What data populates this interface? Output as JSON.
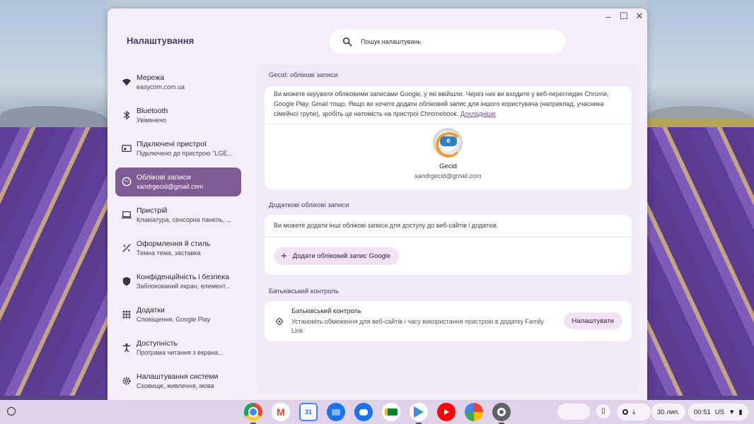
{
  "window": {
    "title": "Налаштування",
    "controls": {
      "minimize": "–",
      "maximize": "☐",
      "close": "✕"
    }
  },
  "search": {
    "placeholder": "Пошук налаштувань"
  },
  "sidebar": {
    "items": [
      {
        "title": "Мережа",
        "subtitle": "easycom.com.ua",
        "icon": "wifi-icon"
      },
      {
        "title": "Bluetooth",
        "subtitle": "Увімкнено",
        "icon": "bluetooth-icon"
      },
      {
        "title": "Підключені пристрої",
        "subtitle": "Підключено до пристрою \"LGE...",
        "icon": "connected-devices-icon"
      },
      {
        "title": "Облікові записи",
        "subtitle": "xandrgecid@gmail.com",
        "icon": "account-icon",
        "active": true
      },
      {
        "title": "Пристрій",
        "subtitle": "Клавіатура, сенсорна панель, ...",
        "icon": "laptop-icon"
      },
      {
        "title": "Оформлення й стиль",
        "subtitle": "Темна тема, заставка",
        "icon": "palette-icon"
      },
      {
        "title": "Конфіденційність і безпека",
        "subtitle": "Заблокований екран, елемент...",
        "icon": "shield-icon"
      },
      {
        "title": "Додатки",
        "subtitle": "Сповіщення, Google Play",
        "icon": "apps-grid-icon"
      },
      {
        "title": "Доступність",
        "subtitle": "Програма читання з екрана...",
        "icon": "accessibility-icon"
      },
      {
        "title": "Налаштування системи",
        "subtitle": "Сховище, живлення, мова",
        "icon": "system-settings-icon"
      }
    ]
  },
  "main": {
    "gecid_section": {
      "title": "Gecid: облікові записи",
      "description": "Ви можете керувати обліковими записами Google, у які ввійшли. Через них ви входите у веб-переглядач Chrome, Google Play, Gmail тощо. Якщо ви хочете додати обліковий запис для іншого користувача (наприклад, учасника сімейної групи), зробіть це натомість на пристрої Chromebook.",
      "learn_more": "Докладніше",
      "account_name": "Gecid",
      "account_email": "xandrgecid@gmail.com"
    },
    "additional_section": {
      "title": "Додаткові облікові записи",
      "description": "Ви можете додати інші облікові записи для доступу до веб-сайтів і додатків.",
      "add_button": "Додати обліковий запис Google"
    },
    "parental_section": {
      "title": "Батьківський контроль",
      "card_title": "Батьківський контроль",
      "card_description": "Установіть обмеження для веб-сайтів і часу використання пристрою в додатку Family Link",
      "setup_button": "Налаштувати"
    }
  },
  "shelf": {
    "apps": [
      {
        "name": "chrome-icon",
        "color": "#dd4b3e",
        "running": true
      },
      {
        "name": "gmail-icon",
        "color": "#ffffff",
        "running": false
      },
      {
        "name": "calendar-icon",
        "color": "#ffffff",
        "running": false
      },
      {
        "name": "files-icon",
        "color": "#1a73e8",
        "running": false
      },
      {
        "name": "messages-icon",
        "color": "#1a73e8",
        "running": false
      },
      {
        "name": "meet-icon",
        "color": "#ffffff",
        "running": false
      },
      {
        "name": "play-store-icon",
        "color": "#ffffff",
        "running": true
      },
      {
        "name": "youtube-icon",
        "color": "#ff0000",
        "running": false
      },
      {
        "name": "photos-icon",
        "color": "#ffffff",
        "running": false
      },
      {
        "name": "settings-icon",
        "color": "#5f6368",
        "running": true
      }
    ],
    "date": "30 лип.",
    "time": "00:51",
    "locale": "US"
  }
}
